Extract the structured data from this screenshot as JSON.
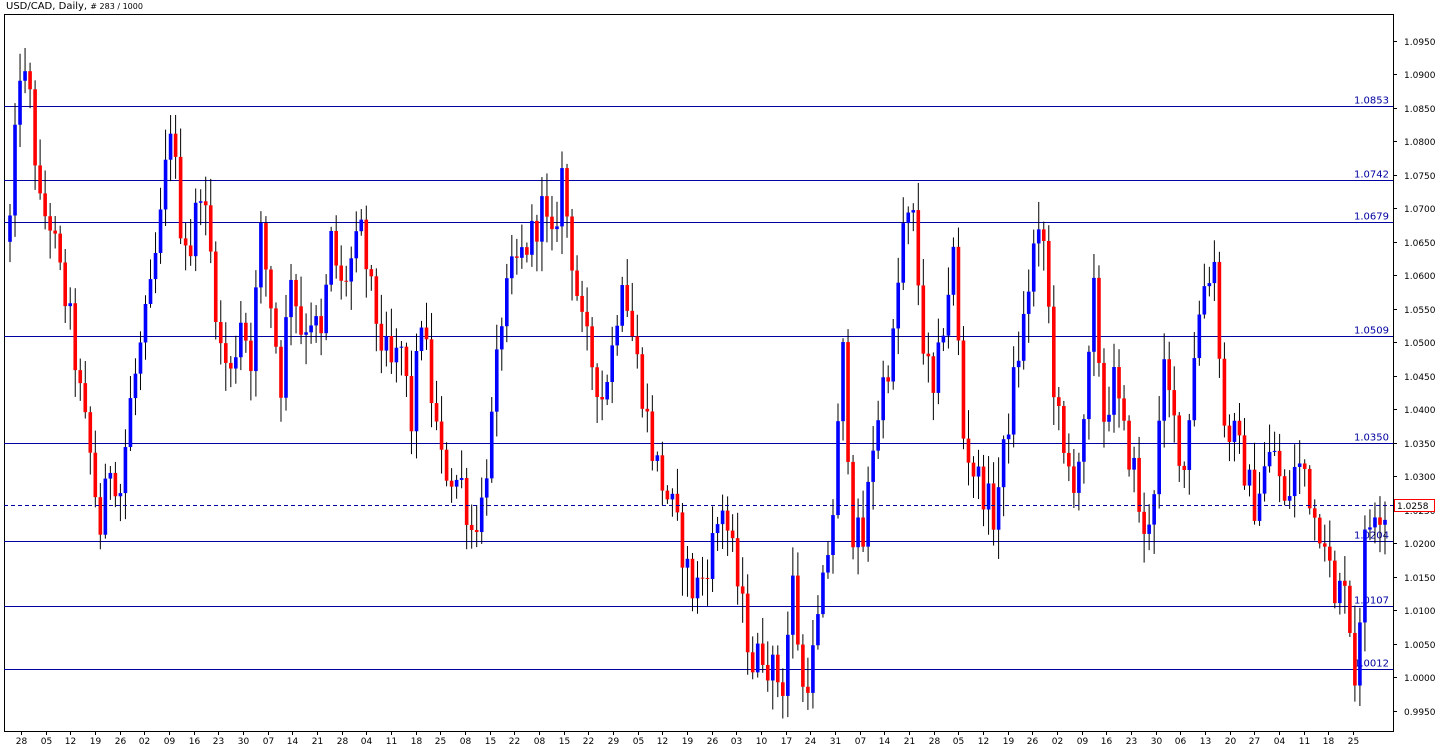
{
  "header": {
    "symbol": "USD/CAD",
    "timeframe": ", Daily, ",
    "bars_info": "# 283 / 1000"
  },
  "colors": {
    "bull": "#0000ff",
    "bear": "#ff0000",
    "wick": "#000000",
    "level_line": "#0000a0",
    "current_line": "#0000a0",
    "current_box": "#ff0000"
  },
  "chart_data": {
    "type": "candlestick",
    "title": "USD/CAD , Daily, # 283 / 1000",
    "ylim": [
      0.992,
      1.099
    ],
    "y_ticks": [
      "0.9950",
      "1.0000",
      "1.0050",
      "1.0100",
      "1.0150",
      "1.0200",
      "1.0250",
      "1.0300",
      "1.0350",
      "1.0400",
      "1.0450",
      "1.0500",
      "1.0550",
      "1.0600",
      "1.0650",
      "1.0700",
      "1.0750",
      "1.0800",
      "1.0850",
      "1.0900",
      "1.0950"
    ],
    "x_ticks": [
      "28",
      "05",
      "12",
      "19",
      "26",
      "02",
      "09",
      "16",
      "23",
      "30",
      "07",
      "14",
      "21",
      "28",
      "04",
      "11",
      "18",
      "25",
      "08",
      "15",
      "22",
      "08",
      "15",
      "22",
      "29",
      "05",
      "12",
      "19",
      "26",
      "03",
      "10",
      "17",
      "24",
      "31",
      "07",
      "14",
      "21",
      "28",
      "05",
      "12",
      "19",
      "26",
      "02",
      "09",
      "16",
      "23",
      "30",
      "06",
      "13",
      "20",
      "27",
      "04",
      "11",
      "18",
      "25"
    ],
    "grid": false,
    "levels": [
      {
        "label": "1.0853",
        "value": 1.0853
      },
      {
        "label": "1.0742",
        "value": 1.0742
      },
      {
        "label": "1.0679",
        "value": 1.0679
      },
      {
        "label": "1.0509",
        "value": 1.0509
      },
      {
        "label": "1.0350",
        "value": 1.035
      },
      {
        "label": "1.0204",
        "value": 1.0204
      },
      {
        "label": "1.0107",
        "value": 1.0107
      },
      {
        "label": "1.0012",
        "value": 1.0012
      }
    ],
    "current_price": {
      "label": "1.0258",
      "value": 1.0258
    },
    "close_path": [
      [
        0,
        1.068
      ],
      [
        2,
        1.091
      ],
      [
        4,
        1.086
      ],
      [
        6,
        1.07
      ],
      [
        8,
        1.068
      ],
      [
        10,
        1.06
      ],
      [
        12,
        1.053
      ],
      [
        14,
        1.042
      ],
      [
        16,
        1.033
      ],
      [
        18,
        1.022
      ],
      [
        20,
        1.032
      ],
      [
        22,
        1.028
      ],
      [
        24,
        1.041
      ],
      [
        26,
        1.049
      ],
      [
        28,
        1.057
      ],
      [
        30,
        1.068
      ],
      [
        32,
        1.083
      ],
      [
        34,
        1.068
      ],
      [
        36,
        1.064
      ],
      [
        38,
        1.074
      ],
      [
        40,
        1.063
      ],
      [
        42,
        1.049
      ],
      [
        44,
        1.045
      ],
      [
        46,
        1.054
      ],
      [
        48,
        1.048
      ],
      [
        50,
        1.066
      ],
      [
        52,
        1.056
      ],
      [
        54,
        1.044
      ],
      [
        56,
        1.061
      ],
      [
        58,
        1.052
      ],
      [
        60,
        1.054
      ],
      [
        62,
        1.05
      ],
      [
        64,
        1.065
      ],
      [
        66,
        1.058
      ],
      [
        68,
        1.062
      ],
      [
        70,
        1.066
      ],
      [
        72,
        1.057
      ],
      [
        74,
        1.05
      ],
      [
        76,
        1.046
      ],
      [
        78,
        1.049
      ],
      [
        80,
        1.038
      ],
      [
        82,
        1.054
      ],
      [
        84,
        1.042
      ],
      [
        86,
        1.032
      ],
      [
        88,
        1.03
      ],
      [
        90,
        1.029
      ],
      [
        92,
        1.022
      ],
      [
        94,
        1.026
      ],
      [
        96,
        1.038
      ],
      [
        98,
        1.054
      ],
      [
        100,
        1.06
      ],
      [
        102,
        1.063
      ],
      [
        104,
        1.066
      ],
      [
        106,
        1.07
      ],
      [
        108,
        1.064
      ],
      [
        110,
        1.075
      ],
      [
        112,
        1.063
      ],
      [
        114,
        1.052
      ],
      [
        116,
        1.047
      ],
      [
        118,
        1.042
      ],
      [
        120,
        1.049
      ],
      [
        122,
        1.061
      ],
      [
        124,
        1.051
      ],
      [
        126,
        1.043
      ],
      [
        128,
        1.034
      ],
      [
        130,
        1.029
      ],
      [
        132,
        1.025
      ],
      [
        134,
        1.019
      ],
      [
        136,
        1.013
      ],
      [
        138,
        1.015
      ],
      [
        140,
        1.02
      ],
      [
        142,
        1.026
      ],
      [
        144,
        1.018
      ],
      [
        146,
        1.01
      ],
      [
        148,
        1.002
      ],
      [
        150,
        1.004
      ],
      [
        152,
        1.001
      ],
      [
        154,
        0.999
      ],
      [
        156,
        1.014
      ],
      [
        158,
        0.998
      ],
      [
        160,
        1.003
      ],
      [
        162,
        1.013
      ],
      [
        164,
        1.025
      ],
      [
        166,
        1.048
      ],
      [
        168,
        1.022
      ],
      [
        170,
        1.02
      ],
      [
        172,
        1.035
      ],
      [
        174,
        1.044
      ],
      [
        176,
        1.05
      ],
      [
        178,
        1.067
      ],
      [
        180,
        1.068
      ],
      [
        182,
        1.05
      ],
      [
        184,
        1.041
      ],
      [
        186,
        1.053
      ],
      [
        188,
        1.063
      ],
      [
        190,
        1.036
      ],
      [
        192,
        1.031
      ],
      [
        194,
        1.028
      ],
      [
        196,
        1.024
      ],
      [
        198,
        1.033
      ],
      [
        200,
        1.044
      ],
      [
        202,
        1.053
      ],
      [
        204,
        1.064
      ],
      [
        206,
        1.065
      ],
      [
        208,
        1.044
      ],
      [
        210,
        1.032
      ],
      [
        212,
        1.03
      ],
      [
        214,
        1.036
      ],
      [
        216,
        1.057
      ],
      [
        218,
        1.039
      ],
      [
        220,
        1.044
      ],
      [
        222,
        1.036
      ],
      [
        224,
        1.031
      ],
      [
        226,
        1.02
      ],
      [
        228,
        1.029
      ],
      [
        230,
        1.045
      ],
      [
        232,
        1.038
      ],
      [
        234,
        1.031
      ],
      [
        236,
        1.049
      ],
      [
        238,
        1.059
      ],
      [
        240,
        1.062
      ],
      [
        242,
        1.037
      ],
      [
        244,
        1.036
      ],
      [
        246,
        1.031
      ],
      [
        248,
        1.026
      ],
      [
        250,
        1.031
      ],
      [
        252,
        1.034
      ],
      [
        254,
        1.025
      ],
      [
        256,
        1.031
      ],
      [
        258,
        1.031
      ],
      [
        260,
        1.024
      ],
      [
        262,
        1.022
      ],
      [
        264,
        1.01
      ],
      [
        266,
        1.016
      ],
      [
        268,
        1.0
      ],
      [
        270,
        1.02
      ],
      [
        272,
        1.026
      ],
      [
        274,
        1.025
      ]
    ]
  }
}
